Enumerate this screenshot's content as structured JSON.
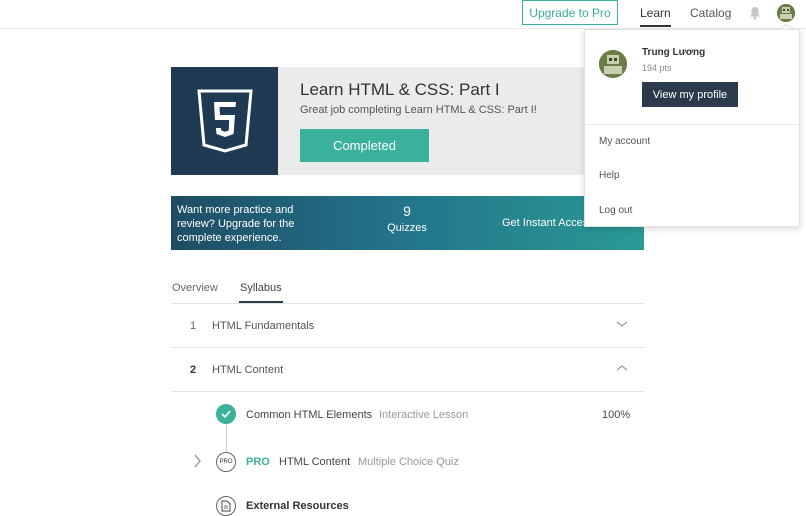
{
  "nav": {
    "upgrade_label": "Upgrade to Pro",
    "learn_label": "Learn",
    "catalog_label": "Catalog",
    "bell_icon": "bell-icon",
    "avatar_icon": "avatar"
  },
  "course": {
    "logo_icon": "html5-icon",
    "title": "Learn HTML & CSS: Part I",
    "subtitle": "Great job completing Learn HTML & CSS: Part I!",
    "status_label": "Completed"
  },
  "banner": {
    "text": "Want more practice and review? Upgrade for the complete experience.",
    "quiz_count": "9",
    "quiz_label": "Quizzes",
    "cta": "Get Instant Access"
  },
  "tabs": {
    "overview": "Overview",
    "syllabus": "Syllabus"
  },
  "syllabus": {
    "units": [
      {
        "num": "1",
        "title": "HTML Fundamentals",
        "expanded": false
      },
      {
        "num": "2",
        "title": "HTML Content",
        "expanded": true
      }
    ],
    "lessons": [
      {
        "name": "Common HTML Elements",
        "type": "Interactive Lesson",
        "progress": "100%",
        "status_icon": "check-icon"
      },
      {
        "badge": "PRO",
        "icon_text": "PRO",
        "name": "HTML Content",
        "type": "Multiple Choice Quiz"
      },
      {
        "name": "External Resources",
        "icon": "document-icon"
      }
    ]
  },
  "dropdown": {
    "user_name": "Trung Lương",
    "points": "194 pts",
    "profile_button": "View my profile",
    "items": [
      "My account",
      "Help",
      "Log out"
    ]
  },
  "colors": {
    "accent": "#3bb09a",
    "dark_navy": "#1f3a52",
    "button_dark": "#2b3b4c"
  }
}
